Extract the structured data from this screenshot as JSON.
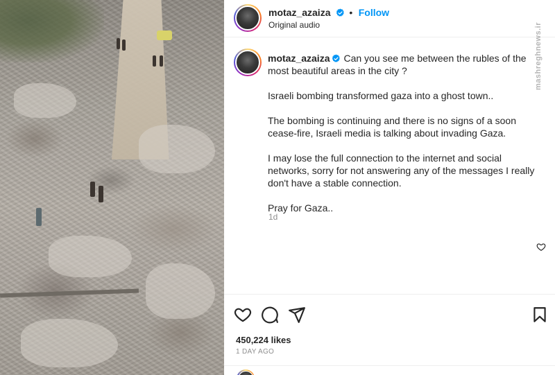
{
  "post": {
    "author": "motaz_azaiza",
    "follow_label": "Follow",
    "separator": "•",
    "audio": "Original audio",
    "caption": {
      "first_line": "Can you see me between the rubles of the most beautiful areas in the city ?",
      "paragraphs": [
        "Israeli bombing transformed gaza into a ghost town..",
        "The bombing is continuing and there is no signs of a soon cease-fire, Israeli media is talking about invading Gaza.",
        "I may lose the full connection to the internet and social networks, sorry for not answering any of the messages I really don't have a stable connection.",
        "Pray for Gaza.."
      ],
      "time_ago": "1d"
    },
    "likes": "450,224 likes",
    "date": "1 DAY AGO"
  },
  "watermark": "mashreghnews.ir",
  "colors": {
    "link_blue": "#0095f6",
    "text": "#262626",
    "muted": "#8e8e8e",
    "divider": "#efefef"
  },
  "icons": {
    "verified": "verified-badge-icon",
    "heart": "heart-icon",
    "comment": "comment-icon",
    "share": "send-icon",
    "save": "bookmark-icon"
  }
}
